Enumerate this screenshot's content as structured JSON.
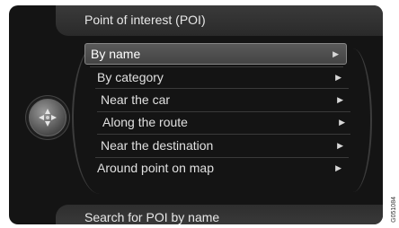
{
  "header": {
    "title": "Point of interest (POI)"
  },
  "menu": {
    "items": [
      {
        "label": "By name",
        "selected": true
      },
      {
        "label": "By category",
        "selected": false
      },
      {
        "label": "Near the car",
        "selected": false
      },
      {
        "label": "Along the route",
        "selected": false
      },
      {
        "label": "Near the destination",
        "selected": false
      },
      {
        "label": "Around point on map",
        "selected": false
      }
    ],
    "arrow_icon": "right-triangle-icon"
  },
  "footer": {
    "help_text": "Search for POI by name"
  },
  "figure_code": "G051084"
}
